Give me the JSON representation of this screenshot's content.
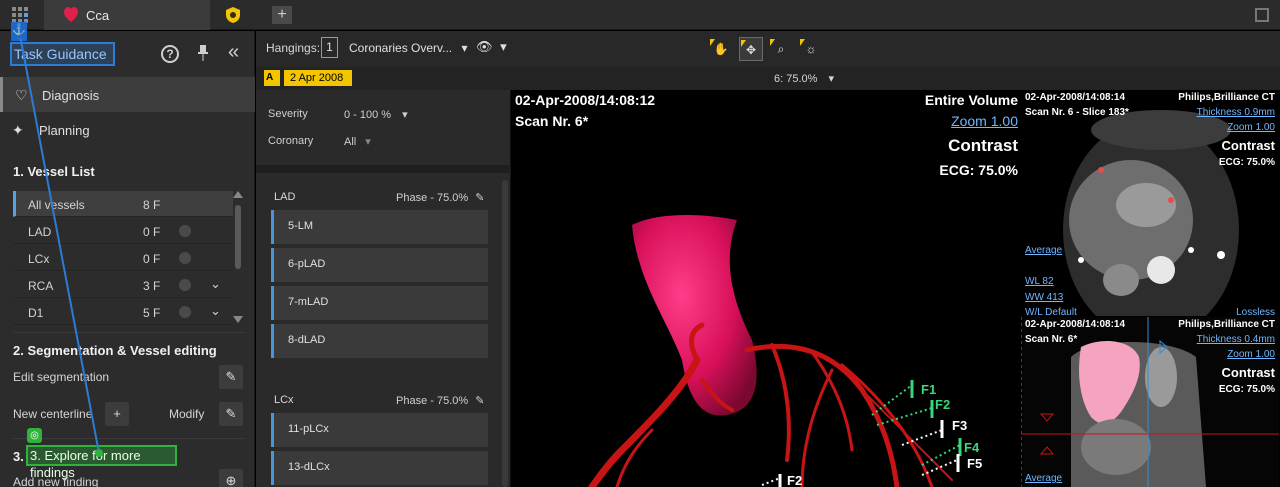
{
  "window": {
    "active_tab_label": "Cca",
    "add_tab_symbol": "+"
  },
  "task_guidance": {
    "title": "Task Guidance",
    "help_symbol": "?",
    "pin_symbol": "📌",
    "collapse_symbol": "«"
  },
  "nav": {
    "diagnosis": "Diagnosis",
    "planning": "Planning"
  },
  "vessel_list": {
    "title": "1.  Vessel List",
    "rows": [
      {
        "name": "All vessels",
        "count": "8 F"
      },
      {
        "name": "LAD",
        "count": "0 F"
      },
      {
        "name": "LCx",
        "count": "0 F"
      },
      {
        "name": "RCA",
        "count": "3 F"
      },
      {
        "name": "D1",
        "count": "5 F"
      }
    ]
  },
  "segmentation": {
    "title": "2.  Segmentation & Vessel editing",
    "edit_label": "Edit segmentation",
    "new_centerline_label": "New centerline",
    "modify_label": "Modify"
  },
  "explore": {
    "title": "3.  Explore for more findings",
    "add_new_label": "Add new finding"
  },
  "toolbar": {
    "hangings_label": "Hangings:",
    "hangings_value": "1",
    "layout_value": "Coronaries Overv...",
    "dropdown_symbol": "▾"
  },
  "datestrip": {
    "a_label": "A",
    "date": "2 Apr 2008",
    "phase": "6: 75.0%"
  },
  "filters": {
    "severity_label": "Severity",
    "severity_value": "0 - 100 %",
    "coronary_label": "Coronary",
    "coronary_value": "All"
  },
  "groups": [
    {
      "name": "LAD",
      "phase": "Phase - 75.0%",
      "segments": [
        "5-LM",
        "6-pLAD",
        "7-mLAD",
        "8-dLAD"
      ]
    },
    {
      "name": "LCx",
      "phase": "Phase - 75.0%",
      "segments": [
        "11-pLCx",
        "13-dLCx"
      ]
    }
  ],
  "main_view": {
    "datetime": "02-Apr-2008/14:08:12",
    "scan": "Scan Nr. 6*",
    "volume": "Entire Volume",
    "zoom": "Zoom 1.00",
    "contrast": "Contrast",
    "ecg": "ECG: 75.0%",
    "findings": [
      "F1",
      "F2",
      "F3",
      "F4",
      "F5",
      "F2"
    ]
  },
  "axial_view": {
    "datetime": "02-Apr-2008/14:08:14",
    "scan": "Scan Nr. 6 - Slice 183*",
    "vendor": "Philips,Brilliance CT",
    "thickness": "Thickness 0.9mm",
    "zoom": "Zoom 1.00",
    "contrast": "Contrast",
    "ecg": "ECG: 75.0%",
    "average": "Average",
    "wl": "WL     82",
    "ww": "WW   413",
    "wl_default": "W/L Default",
    "lossless": "Lossless"
  },
  "sagittal_view": {
    "datetime": "02-Apr-2008/14:08:14",
    "scan": "Scan Nr. 6*",
    "vendor": "Philips,Brilliance CT",
    "thickness": "Thickness 0.4mm",
    "zoom": "Zoom 1.00",
    "contrast": "Contrast",
    "ecg": "ECG: 75.0%",
    "average": "Average"
  },
  "colors": {
    "accent_blue": "#2d7bd4",
    "accent_green": "#2fb33a",
    "accent_yellow": "#f2c500",
    "aorta": "#e0105a",
    "vessels": "#c81414",
    "finding_green": "#3ad67a"
  }
}
